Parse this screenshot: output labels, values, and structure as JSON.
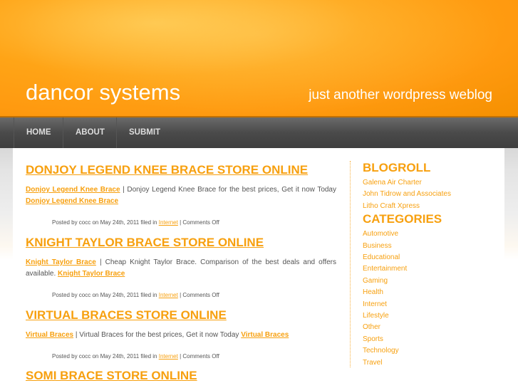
{
  "header": {
    "title": "dancor systems",
    "tagline": "just another wordpress weblog"
  },
  "nav": [
    "HOME",
    "ABOUT",
    "SUBMIT"
  ],
  "posts": [
    {
      "title": "DONJOY LEGEND KNEE BRACE STORE ONLINE",
      "link": "Donjoy Legend Knee Brace",
      "text": " | Donjoy Legend Knee Brace for the best prices, Get it now Today ",
      "link2": "Donjoy Legend Knee Brace",
      "meta_pre": "Posted by cocc on May 24th, 2011 filed in ",
      "category": "Internet",
      "meta_post": " | Comments Off"
    },
    {
      "title": "KNIGHT TAYLOR BRACE STORE ONLINE",
      "link": "Knight Taylor Brace",
      "text": " | Cheap Knight Taylor Brace. Comparison of the best deals and offers available. ",
      "link2": "Knight Taylor Brace",
      "meta_pre": "Posted by cocc on May 24th, 2011 filed in ",
      "category": "Internet",
      "meta_post": " | Comments Off"
    },
    {
      "title": "VIRTUAL BRACES STORE ONLINE",
      "link": "Virtual Braces",
      "text": " | Virtual Braces for the best prices, Get it now Today ",
      "link2": "Virtual Braces",
      "meta_pre": "Posted by cocc on May 24th, 2011 filed in ",
      "category": "Internet",
      "meta_post": " | Comments Off"
    },
    {
      "title": "SOMI BRACE STORE ONLINE"
    }
  ],
  "sidebar": {
    "blogroll_title": "BLOGROLL",
    "blogroll": [
      "Galena Air Charter",
      "John Tidrow and Associates",
      "Litho Craft Xpress"
    ],
    "categories_title": "CATEGORIES",
    "categories": [
      "Automotive",
      "Business",
      "Educational",
      "Entertainment",
      "Gaming",
      "Health",
      "Internet",
      "Lifestyle",
      "Other",
      "Sports",
      "Technology",
      "Travel"
    ]
  }
}
